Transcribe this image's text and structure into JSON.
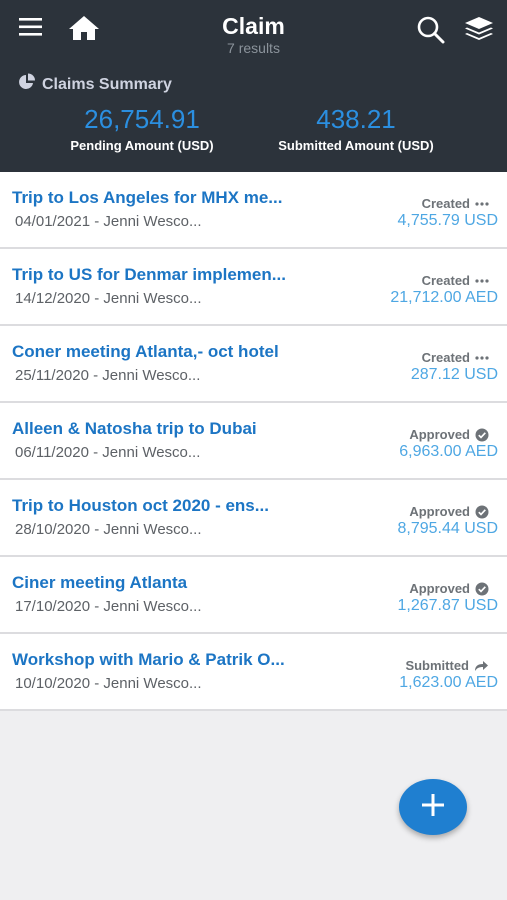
{
  "header": {
    "title": "Claim",
    "subtitle": "7 results",
    "icons": [
      "menu-icon",
      "home-icon",
      "search-icon",
      "layers-icon"
    ]
  },
  "summary": {
    "heading": "Claims Summary",
    "pending_amount": "26,754.91",
    "pending_label": "Pending Amount (USD)",
    "submitted_amount": "438.21",
    "submitted_label": "Submitted Amount (USD)"
  },
  "claims": [
    {
      "title": "Trip to Los Angeles for MHX me...",
      "sub": "04/01/2021 - Jenni Wesco...",
      "status": "Created",
      "status_icon": "more-icon",
      "amount": "4,755.79 USD"
    },
    {
      "title": "Trip to US for Denmar implemen...",
      "sub": "14/12/2020 - Jenni Wesco...",
      "status": "Created",
      "status_icon": "more-icon",
      "amount": "21,712.00 AED"
    },
    {
      "title": "Coner meeting Atlanta,- oct hotel",
      "sub": "25/11/2020 - Jenni Wesco...",
      "status": "Created",
      "status_icon": "more-icon",
      "amount": "287.12 USD"
    },
    {
      "title": "Alleen & Natosha trip to Dubai",
      "sub": "06/11/2020 - Jenni Wesco...",
      "status": "Approved",
      "status_icon": "check-circle-icon",
      "amount": "6,963.00 AED"
    },
    {
      "title": "Trip to Houston oct 2020 - ens...",
      "sub": "28/10/2020 - Jenni Wesco...",
      "status": "Approved",
      "status_icon": "check-circle-icon",
      "amount": "8,795.44 USD"
    },
    {
      "title": "Ciner meeting Atlanta",
      "sub": "17/10/2020 - Jenni Wesco...",
      "status": "Approved",
      "status_icon": "check-circle-icon",
      "amount": "1,267.87 USD"
    },
    {
      "title": "Workshop with Mario & Patrik O...",
      "sub": "10/10/2020 - Jenni Wesco...",
      "status": "Submitted",
      "status_icon": "forward-arrow-icon",
      "amount": "1,623.00 AED"
    }
  ],
  "fab": {
    "icon": "plus-icon"
  },
  "colors": {
    "header_bg": "#2c333b",
    "link_blue": "#1c75c4",
    "amount_blue": "#4ea7e3",
    "summary_amount_blue": "#2b8fe0",
    "fab_blue": "#1f7fd0"
  }
}
